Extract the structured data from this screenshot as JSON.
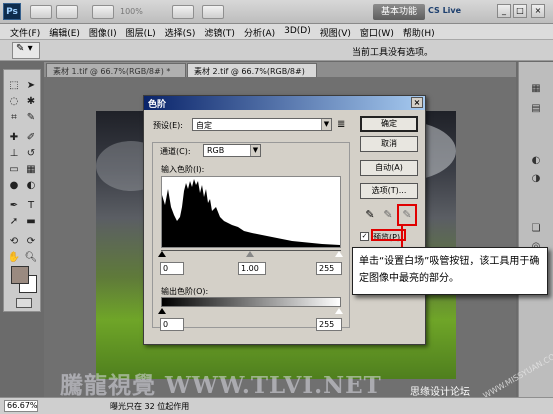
{
  "app": {
    "logo": "Ps",
    "zoom": "100%",
    "workspace": "基本功能",
    "cslive": "CS Live"
  },
  "menu": [
    "文件(F)",
    "编辑(E)",
    "图像(I)",
    "图层(L)",
    "选择(S)",
    "滤镜(T)",
    "分析(A)",
    "3D(D)",
    "视图(V)",
    "窗口(W)",
    "帮助(H)"
  ],
  "options_bar": {
    "tool_icon": "eyedropper-icon",
    "hint": "当前工具没有选项。"
  },
  "tabs": [
    {
      "label": "素材 1.tif @ 66.7%(RGB/8#) *"
    },
    {
      "label": "素材 2.tif @ 66.7%(RGB/8#)"
    }
  ],
  "levels_dialog": {
    "title": "色阶",
    "preset_label": "预设(E):",
    "preset_value": "自定",
    "channel_label": "通道(C):",
    "channel_value": "RGB",
    "input_label": "输入色阶(I):",
    "input_black": "0",
    "input_gamma": "1.00",
    "input_white": "255",
    "output_label": "输出色阶(O):",
    "output_black": "0",
    "output_white": "255",
    "buttons": {
      "ok": "确定",
      "cancel": "取消",
      "auto": "自动(A)",
      "options": "选项(T)..."
    },
    "preview_label": "预览(P)",
    "preview_checked": true,
    "eyedroppers": [
      "black-point-eyedropper-icon",
      "gray-point-eyedropper-icon",
      "white-point-eyedropper-icon"
    ]
  },
  "callout": {
    "text": "单击“设置白场”吸管按钮，该工具用于确定图像中最亮的部分。"
  },
  "status": {
    "zoom": "66.67%",
    "text": "曝光只在 32 位起作用"
  },
  "watermarks": {
    "site": "騰龍視覺 WWW.TLVI.NET",
    "forum": "思缘设计论坛",
    "url": "WWW.MISSYUAN.COM"
  },
  "colors": {
    "highlight": "#e00000",
    "title_bar": "#0a246a",
    "foreground_swatch": "#9a8a80"
  }
}
